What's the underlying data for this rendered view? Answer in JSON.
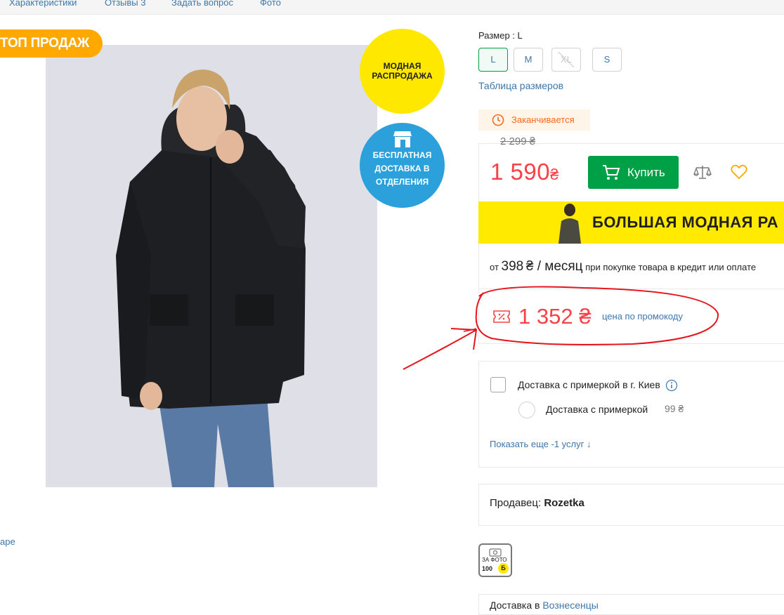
{
  "nav": {
    "tabs": [
      "Характеристики",
      "Отзывы 3",
      "Задать вопрос",
      "Фото"
    ]
  },
  "badges": {
    "top_sales": "ТОП ПРОДАЖ",
    "sale_line1": "МОДНАЯ",
    "sale_line2": "РАСПРОДАЖА",
    "ship_line1": "БЕСПЛАТНАЯ",
    "ship_line2": "ДОСТАВКА В",
    "ship_line3": "ОТДЕЛЕНИЯ"
  },
  "left_link": "аре",
  "size": {
    "title": "Размер : L",
    "options": [
      {
        "label": "L",
        "state": "selected"
      },
      {
        "label": "M",
        "state": "available"
      },
      {
        "label": "XL",
        "state": "unavailable"
      },
      {
        "label": "S",
        "state": "available"
      }
    ],
    "table_link": "Таблица размеров"
  },
  "ending_label": "Заканчивается",
  "price": {
    "old": "2 299 ₴",
    "current": "1 590",
    "currency": "₴",
    "buy_label": "Купить",
    "compare_icon": "scales-icon",
    "wishlist_icon": "heart-icon"
  },
  "banner_text": "БОЛЬШАЯ МОДНАЯ РА",
  "credit": {
    "prefix": "от",
    "amount": "398",
    "unit": "₴ / месяц",
    "suffix": "при покупке товара в кредит или оплате"
  },
  "promo": {
    "price": "1 352 ₴",
    "label": "цена по промокоду"
  },
  "delivery": {
    "checkbox_label": "Доставка с примеркой в г. Киев",
    "option_label": "Доставка с примеркой",
    "option_price": "99 ₴",
    "more_link": "Показать еще -1 услуг ↓"
  },
  "seller": {
    "label": "Продавец:",
    "name": "Rozetka"
  },
  "photo_bonus": {
    "line1": "ЗА ФОТО",
    "points": "100",
    "currency_badge": "Б"
  },
  "bottom_row": {
    "label": "Доставка в",
    "link": "Вознесенцы"
  },
  "colors": {
    "green": "#00a046",
    "red_price": "#f84147",
    "link_blue": "#3e77aa",
    "yellow": "#ffe800",
    "orange_badge": "#ffa900",
    "blue_circle": "#2ba0da"
  }
}
